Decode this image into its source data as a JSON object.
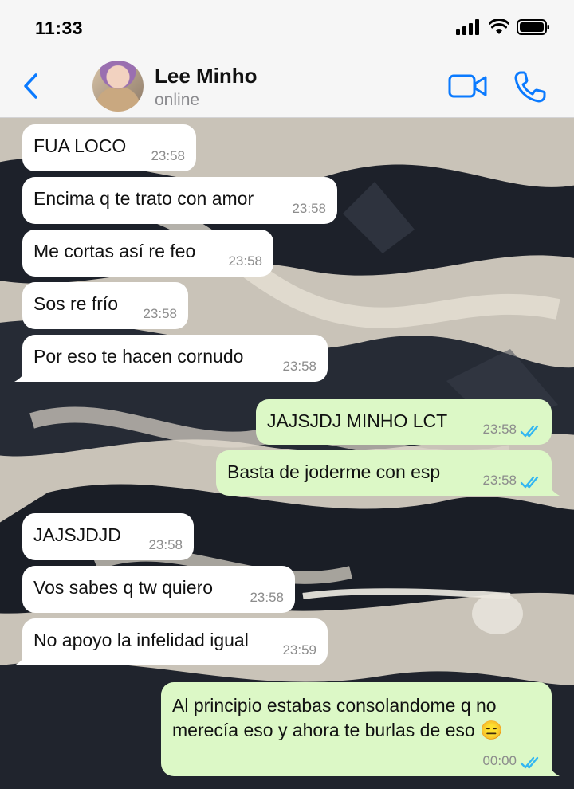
{
  "status_bar": {
    "time": "11:33"
  },
  "header": {
    "contact_name": "Lee Minho",
    "contact_status": "online"
  },
  "messages": [
    {
      "dir": "in",
      "text": "FUA LOCO",
      "time": "23:58"
    },
    {
      "dir": "in",
      "text": "Encima q te trato con amor",
      "time": "23:58"
    },
    {
      "dir": "in",
      "text": "Me cortas así re feo",
      "time": "23:58"
    },
    {
      "dir": "in",
      "text": "Sos re frío",
      "time": "23:58"
    },
    {
      "dir": "in",
      "text": "Por eso te hacen cornudo",
      "time": "23:58"
    },
    {
      "dir": "out",
      "text": "JAJSJDJ MINHO LCT",
      "time": "23:58",
      "status": "read"
    },
    {
      "dir": "out",
      "text": "Basta de joderme con esp",
      "time": "23:58",
      "status": "read"
    },
    {
      "dir": "in",
      "text": "JAJSJDJD",
      "time": "23:58"
    },
    {
      "dir": "in",
      "text": "Vos sabes q tw quiero",
      "time": "23:58"
    },
    {
      "dir": "in",
      "text": "No apoyo la infelidad igual",
      "time": "23:59"
    },
    {
      "dir": "out",
      "text": "Al principio estabas consolandome q no merecía eso y ahora te burlas de eso 😑",
      "time": "00:00",
      "status": "read"
    }
  ],
  "colors": {
    "accent": "#0a7aff",
    "incoming_bubble": "#ffffff",
    "outgoing_bubble": "#dcf8c6",
    "read_ticks": "#34b7f1"
  }
}
